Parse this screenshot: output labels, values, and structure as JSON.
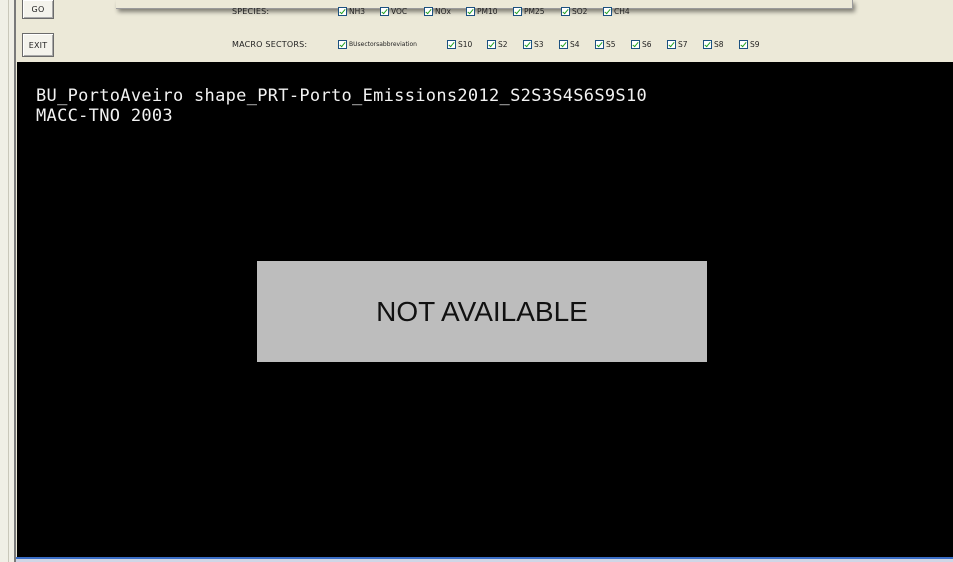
{
  "buttons": {
    "go": "GO",
    "exit": "EXIT"
  },
  "species": {
    "label": "SPECIES:",
    "items": [
      "NH3",
      "VOC",
      "NOx",
      "PM10",
      "PM25",
      "SO2",
      "CH4"
    ]
  },
  "macro_sectors": {
    "label": "MACRO SECTORS:",
    "items": [
      "BUsectorsabbreviation",
      "S10",
      "S2",
      "S3",
      "S4",
      "S5",
      "S6",
      "S7",
      "S8",
      "S9"
    ]
  },
  "display": {
    "line1": "BU_PortoAveiro shape_PRT-Porto_Emissions2012_S2S3S4S6S9S10",
    "line2": "MACC-TNO 2003",
    "message": "NOT AVAILABLE"
  },
  "colors": {
    "check": "#21a121",
    "display_bg": "#000000",
    "message_bg": "#bdbdbd",
    "window_bg": "#ece9d8"
  }
}
